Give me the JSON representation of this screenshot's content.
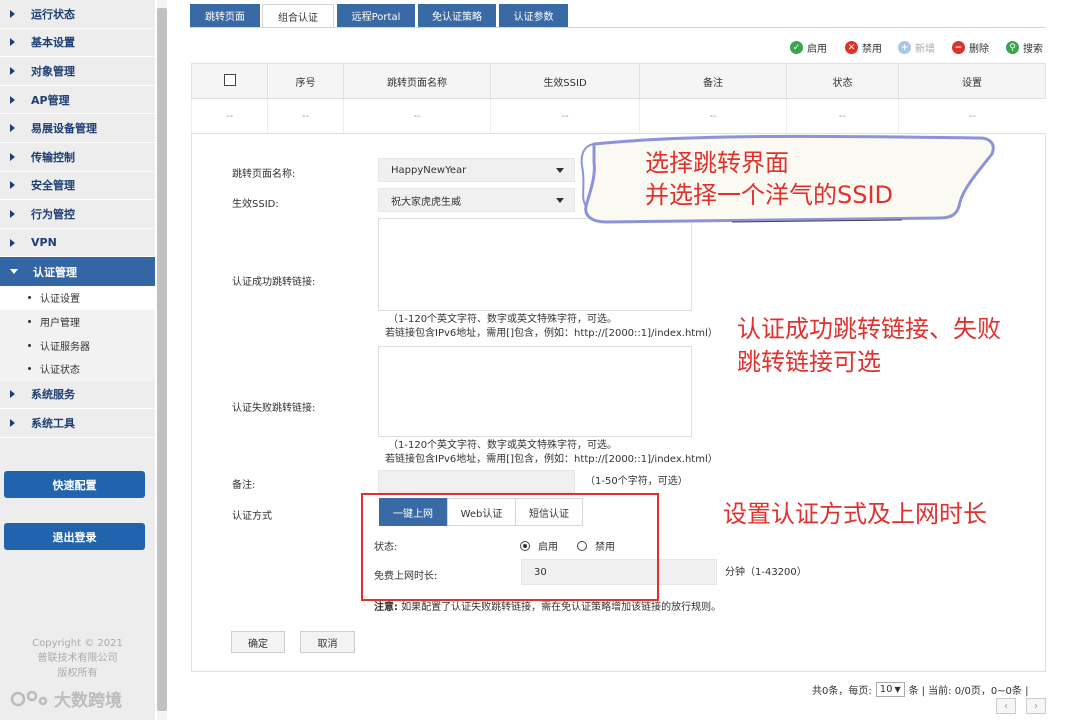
{
  "sidebar": {
    "items_top": [
      {
        "label": "运行状态"
      },
      {
        "label": "基本设置"
      },
      {
        "label": "对象管理"
      },
      {
        "label": "AP管理"
      },
      {
        "label": "易展设备管理"
      },
      {
        "label": "传输控制"
      },
      {
        "label": "安全管理"
      },
      {
        "label": "行为管控"
      },
      {
        "label": "VPN"
      }
    ],
    "active_item": {
      "label": "认证管理"
    },
    "sub_items": [
      {
        "label": "认证设置"
      },
      {
        "label": "用户管理"
      },
      {
        "label": "认证服务器"
      },
      {
        "label": "认证状态"
      }
    ],
    "items_bottom": [
      {
        "label": "系统服务"
      },
      {
        "label": "系统工具"
      }
    ],
    "quick_config": "快速配置",
    "logout": "退出登录",
    "copyright": [
      "Copyright © 2021",
      "普联技术有限公司",
      "版权所有"
    ],
    "watermark": "大数跨境",
    "accent_color": "#3466a5"
  },
  "tabs": [
    {
      "label": "跳转页面",
      "active": false
    },
    {
      "label": "组合认证",
      "active": true
    },
    {
      "label": "远程Portal",
      "active": false
    },
    {
      "label": "免认证策略",
      "active": false
    },
    {
      "label": "认证参数",
      "active": false
    }
  ],
  "toolbar": {
    "enable": "启用",
    "disable": "禁用",
    "add": "新增",
    "delete": "删除",
    "search": "搜索"
  },
  "table": {
    "columns": [
      "序号",
      "跳转页面名称",
      "生效SSID",
      "备注",
      "状态",
      "设置"
    ],
    "empty_cell": "--"
  },
  "form": {
    "page_name_label": "跳转页面名称:",
    "page_name_value": "HappyNewYear",
    "ssid_label": "生效SSID:",
    "ssid_value": "祝大家虎虎生威",
    "success_url_label": "认证成功跳转链接:",
    "success_hint_1": "（1-120个英文字符、数字或英文特殊字符，可选。",
    "success_hint_2": "若链接包含IPv6地址，需用[]包含，例如：http://[2000::1]/index.html）",
    "fail_url_label": "认证失败跳转链接:",
    "fail_hint_1": "（1-120个英文字符、数字或英文特殊字符，可选。",
    "fail_hint_2": "若链接包含IPv6地址，需用[]包含，例如：http://[2000::1]/index.html）",
    "remark_label": "备注:",
    "remark_hint": "（1-50个字符，可选）",
    "auth_mode_label": "认证方式",
    "mode_tabs": [
      {
        "label": "一键上网",
        "active": true
      },
      {
        "label": "Web认证",
        "active": false
      },
      {
        "label": "短信认证",
        "active": false
      }
    ],
    "status_label": "状态:",
    "status_on": "启用",
    "status_off": "禁用",
    "status_selected": "启用",
    "duration_label": "免费上网时长:",
    "duration_value": "30",
    "duration_unit": "分钟（1-43200）",
    "note_bold": "注意:",
    "note_text": "如果配置了认证失败跳转链接，需在免认证策略增加该链接的放行规则。",
    "ok": "确定",
    "cancel": "取消"
  },
  "annotations": {
    "callout_line1": "选择跳转界面",
    "callout_line2": "并选择一个洋气的SSID",
    "note2_line1": "认证成功跳转链接、失败",
    "note2_line2": "跳转链接可选",
    "note3": "设置认证方式及上网时长",
    "color": "#e0312e"
  },
  "pagination": {
    "total": "共0条，每页:",
    "page_size": "10",
    "unit": "条",
    "current": "| 当前: 0/0页，0~0条 |"
  }
}
